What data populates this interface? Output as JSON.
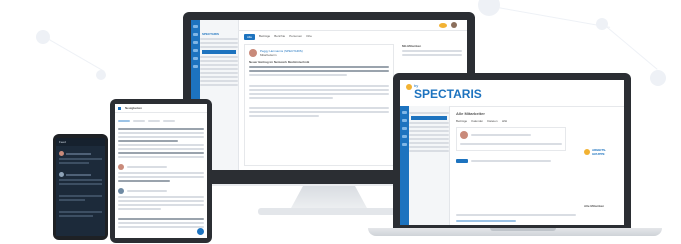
{
  "brand": {
    "primary": "#1d73bf",
    "frame": "#2b2e33",
    "logo_prefix": "by",
    "logo_name": "SPECTARIS",
    "group_logo_line1": "ARBEITS-",
    "group_logo_line2": "GRUPPE"
  },
  "desktop": {
    "side_title": "SPECTARIS",
    "feed_tabs": [
      "Alle",
      "Beiträge",
      "Berichte",
      "Personen",
      "Orte"
    ],
    "post_author": "Peggy Hermanns (SPECTARIS)",
    "post_meta": "Mitarbeiterin",
    "post_body": "Neuer Beitrag im Netzwerk Medizintechnik",
    "right_panel_title": "Mit-Mitwirken"
  },
  "laptop": {
    "page_title": "Alle Mitarbeiter",
    "tabs": [
      "Beiträge",
      "Kalender",
      "Dateien",
      "Wiki"
    ],
    "right_panel_title": "Alle Mitwirken"
  },
  "tablet": {
    "title": "Neuigkeiten"
  },
  "phone": {
    "title": "Feed"
  }
}
